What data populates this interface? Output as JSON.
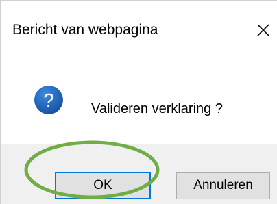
{
  "dialog": {
    "title": "Bericht van webpagina",
    "close_icon": "close-icon",
    "message": "Valideren verklaring ?",
    "message_icon": "question-icon",
    "buttons": {
      "ok_label": "OK",
      "cancel_label": "Annuleren"
    }
  },
  "colors": {
    "icon_blue": "#1a5fb4",
    "focus_border": "#0078d7",
    "highlight_ring": "#70ad47",
    "footer_bg": "#f0f0f0",
    "button_bg": "#e1e1e1"
  }
}
